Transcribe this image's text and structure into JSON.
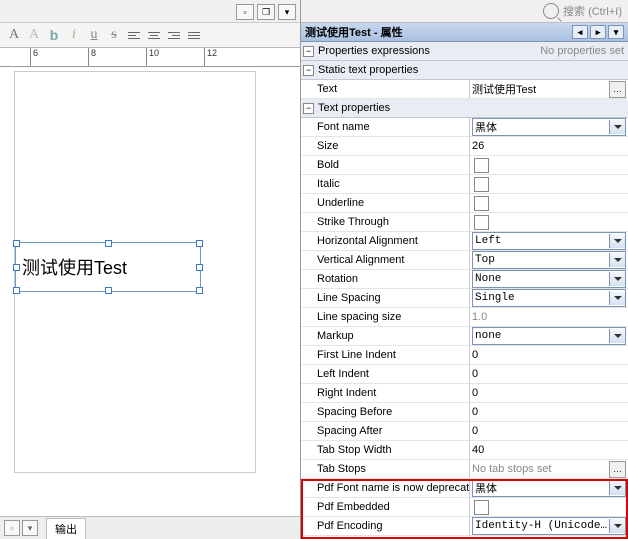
{
  "search": {
    "placeholder": "搜索 (Ctrl+I)"
  },
  "toolbar": {
    "a1": "A",
    "a2": "A",
    "b": "b",
    "i": "i",
    "u": "u",
    "s": "s"
  },
  "ruler": {
    "ticks": [
      "6",
      "8",
      "10",
      "12"
    ]
  },
  "canvas": {
    "text_obj": "测试使用Test"
  },
  "bottom_tab": "输出",
  "panel_title": "测试使用Test - 属性",
  "sections": {
    "props_expr": {
      "label": "Properties expressions",
      "value": "No properties set"
    },
    "static_text": "Static text properties",
    "text_props": "Text properties"
  },
  "props": {
    "text": {
      "label": "Text",
      "value": "测试使用Test"
    },
    "font_name": {
      "label": "Font name",
      "value": "黑体"
    },
    "size": {
      "label": "Size",
      "value": "26"
    },
    "bold": {
      "label": "Bold"
    },
    "italic": {
      "label": "Italic"
    },
    "underline": {
      "label": "Underline"
    },
    "strike": {
      "label": "Strike Through"
    },
    "halign": {
      "label": "Horizontal Alignment",
      "value": "Left"
    },
    "valign": {
      "label": "Vertical Alignment",
      "value": "Top"
    },
    "rotation": {
      "label": "Rotation",
      "value": "None"
    },
    "line_spacing": {
      "label": "Line Spacing",
      "value": "Single"
    },
    "line_spacing_size": {
      "label": "Line spacing size",
      "value": "1.0"
    },
    "markup": {
      "label": "Markup",
      "value": "none"
    },
    "first_line_indent": {
      "label": "First Line Indent",
      "value": "0"
    },
    "left_indent": {
      "label": "Left Indent",
      "value": "0"
    },
    "right_indent": {
      "label": "Right Indent",
      "value": "0"
    },
    "spacing_before": {
      "label": "Spacing Before",
      "value": "0"
    },
    "spacing_after": {
      "label": "Spacing After",
      "value": "0"
    },
    "tab_stop_width": {
      "label": "Tab Stop Width",
      "value": "40"
    },
    "tab_stops": {
      "label": "Tab Stops",
      "value": "No tab stops set"
    },
    "pdf_font": {
      "label": "Pdf Font name is now deprecate",
      "value": "黑体"
    },
    "pdf_embedded": {
      "label": "Pdf Embedded"
    },
    "pdf_encoding": {
      "label": "Pdf Encoding",
      "value": "Identity-H (Unicode..."
    }
  }
}
